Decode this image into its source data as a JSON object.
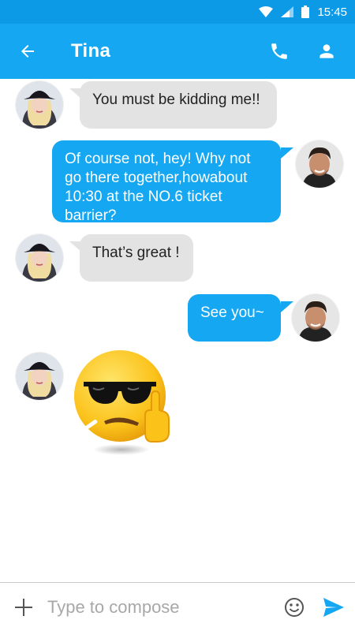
{
  "status_bar": {
    "time": "15:45"
  },
  "header": {
    "contact_name": "Tina",
    "back_icon": "arrow-left-icon",
    "call_icon": "phone-icon",
    "profile_icon": "person-icon"
  },
  "messages": [
    {
      "from": "Tina",
      "direction": "incoming",
      "text": "You must be kidding me!!"
    },
    {
      "from": "me",
      "direction": "outgoing",
      "text": "Of course not, hey! Why not go there together,howabout 10:30 at the NO.6 ticket barrier?"
    },
    {
      "from": "Tina",
      "direction": "incoming",
      "text": "That’s great !"
    },
    {
      "from": "me",
      "direction": "outgoing",
      "text": "See you~"
    },
    {
      "from": "Tina",
      "direction": "incoming",
      "sticker": "sunglasses-emoji-middle-finger-sticker"
    }
  ],
  "compose": {
    "placeholder": "Type to compose",
    "value": "",
    "add_icon": "plus-icon",
    "emoji_icon": "smiley-icon",
    "send_icon": "send-icon"
  },
  "colors": {
    "status_bar": "#0c9ae6",
    "app_bar": "#15a7f2",
    "outgoing_bubble": "#15a7f2",
    "incoming_bubble": "#e3e3e3"
  }
}
